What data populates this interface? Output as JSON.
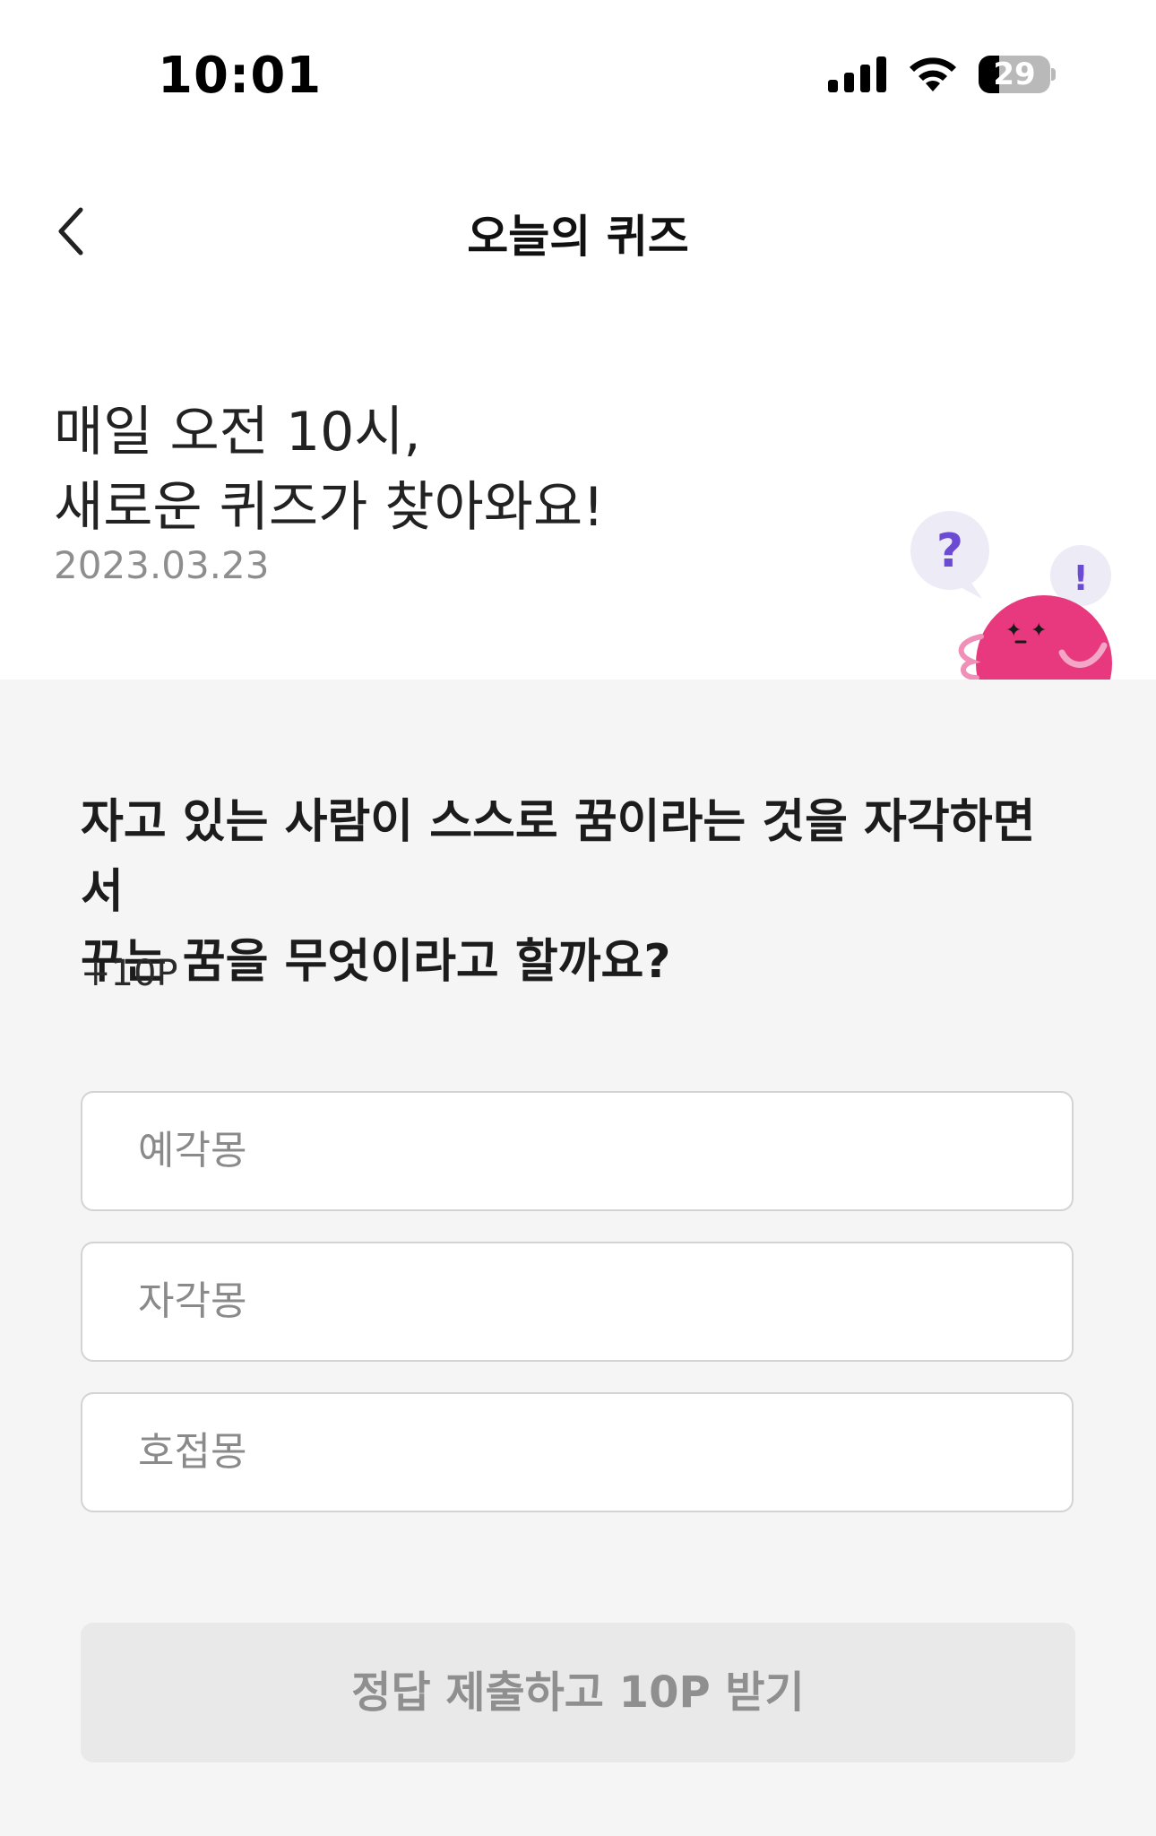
{
  "status_bar": {
    "time": "10:01",
    "battery_level": "29",
    "battery_fraction": 0.29,
    "icons": [
      "cellular-signal-icon",
      "wifi-icon",
      "battery-icon"
    ]
  },
  "header": {
    "title": "오늘의 퀴즈",
    "back_icon": "chevron-left-icon"
  },
  "intro": {
    "headline_line1": "매일 오전 10시,",
    "headline_line2": "새로운 퀴즈가 찾아와요!",
    "date": "2023.03.23",
    "bubble_question_mark": "?",
    "bubble_exclamation_mark": "!",
    "mascot_icon": "pink-mascot-icon"
  },
  "quiz": {
    "question_line1": "자고 있는 사람이 스스로 꿈이라는 것을 자각하면서",
    "question_line2": "꾸는 꿈을 무엇이라고 할까요?",
    "points": "+10P",
    "options": [
      {
        "label": "예각몽"
      },
      {
        "label": "자각몽"
      },
      {
        "label": "호접몽"
      }
    ],
    "submit_label": "정답 제출하고 10P 받기"
  },
  "colors": {
    "mascot_pink": "#E8397F",
    "bubble_bg": "#EDEBF6",
    "bubble_mark": "#6A4BD1",
    "section_bg": "#F5F5F5",
    "disabled_button_bg": "#E9E9E9"
  }
}
